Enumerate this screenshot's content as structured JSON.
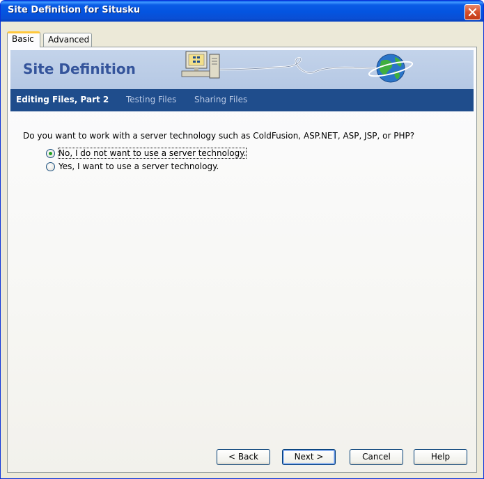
{
  "window": {
    "title": "Site Definition for Situsku"
  },
  "tabs": [
    {
      "label": "Basic"
    },
    {
      "label": "Advanced"
    }
  ],
  "banner": {
    "title": "Site Definition"
  },
  "steps": [
    {
      "label": "Editing Files, Part 2"
    },
    {
      "label": "Testing Files"
    },
    {
      "label": "Sharing Files"
    }
  ],
  "question": "Do you want to work with a server technology such as ColdFusion, ASP.NET, ASP, JSP, or PHP?",
  "options": [
    {
      "label": "No, I do not want to use a server technology.",
      "checked": true
    },
    {
      "label": "Yes, I want to use a server technology.",
      "checked": false
    }
  ],
  "buttons": {
    "back": "< Back",
    "next": "Next >",
    "cancel": "Cancel",
    "help": "Help"
  },
  "colors": {
    "title_bar": "#0a5ce6",
    "step_bar": "#1f4d8c",
    "banner": "#c3d3ea",
    "close_button": "#d4502c"
  },
  "icons": [
    "close-icon",
    "computer-icon",
    "globe-icon"
  ]
}
